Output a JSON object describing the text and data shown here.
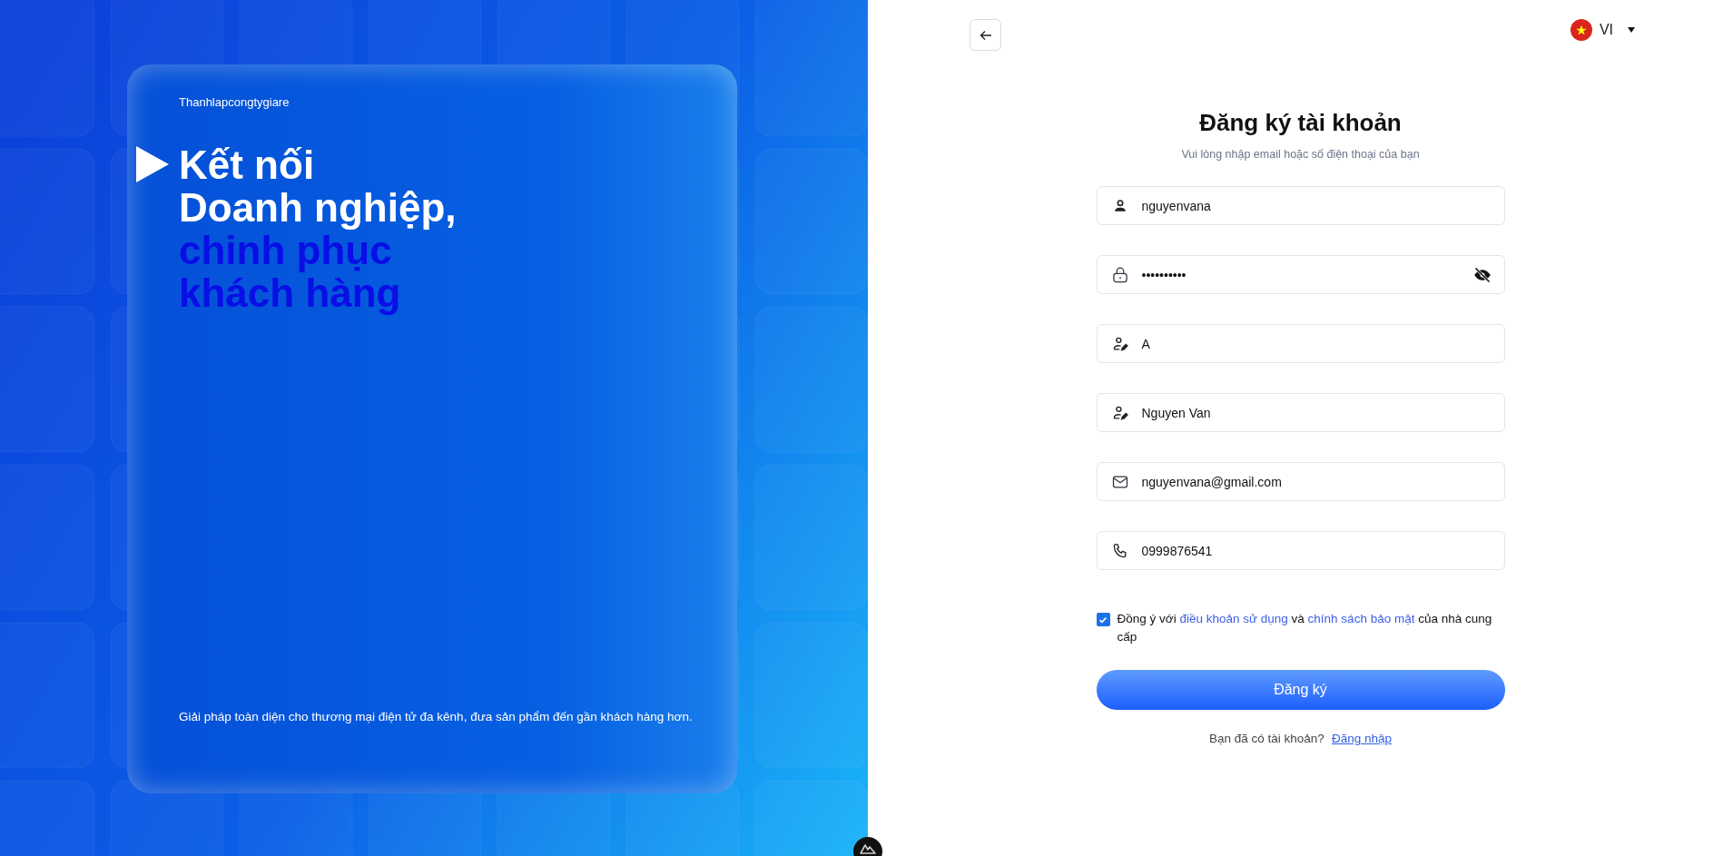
{
  "hero": {
    "brand": "Thanhlapcongtygiare",
    "lines": [
      {
        "text": "Kết nối",
        "accent": false
      },
      {
        "text": "Doanh nghiệp,",
        "accent": false
      },
      {
        "text": "chinh phục",
        "accent": true
      },
      {
        "text": "khách hàng",
        "accent": true
      }
    ],
    "description": "Giải pháp toàn diện cho thương mại điện tử đa kênh, đưa sản phẩm đến gần khách hàng hơn."
  },
  "language": {
    "code": "VI"
  },
  "title": "Đăng ký tài khoản",
  "subtitle": "Vui lòng nhập email hoặc số điện thoại của bạn",
  "fields": [
    {
      "kind": "username",
      "value": "nguyenvana"
    },
    {
      "kind": "password",
      "value": "••••••••••"
    },
    {
      "kind": "givenname",
      "value": "A"
    },
    {
      "kind": "familyname",
      "value": "Nguyen Van"
    },
    {
      "kind": "email",
      "value": "nguyenvana@gmail.com"
    },
    {
      "kind": "phone",
      "value": "0999876541"
    }
  ],
  "agreement": {
    "checked": true,
    "parts": [
      {
        "kind": "text",
        "text": "Đồng ý với"
      },
      {
        "kind": "link",
        "text": "điều khoản sử dụng"
      },
      {
        "kind": "text",
        "text": "và"
      },
      {
        "kind": "link",
        "text": "chính sách bảo mật"
      },
      {
        "kind": "text",
        "text": "của nhà cung cấp"
      }
    ]
  },
  "submit": "Đăng ký",
  "login": {
    "prompt": "Bạn đã có tài khoản?",
    "link": "Đăng nhập"
  }
}
